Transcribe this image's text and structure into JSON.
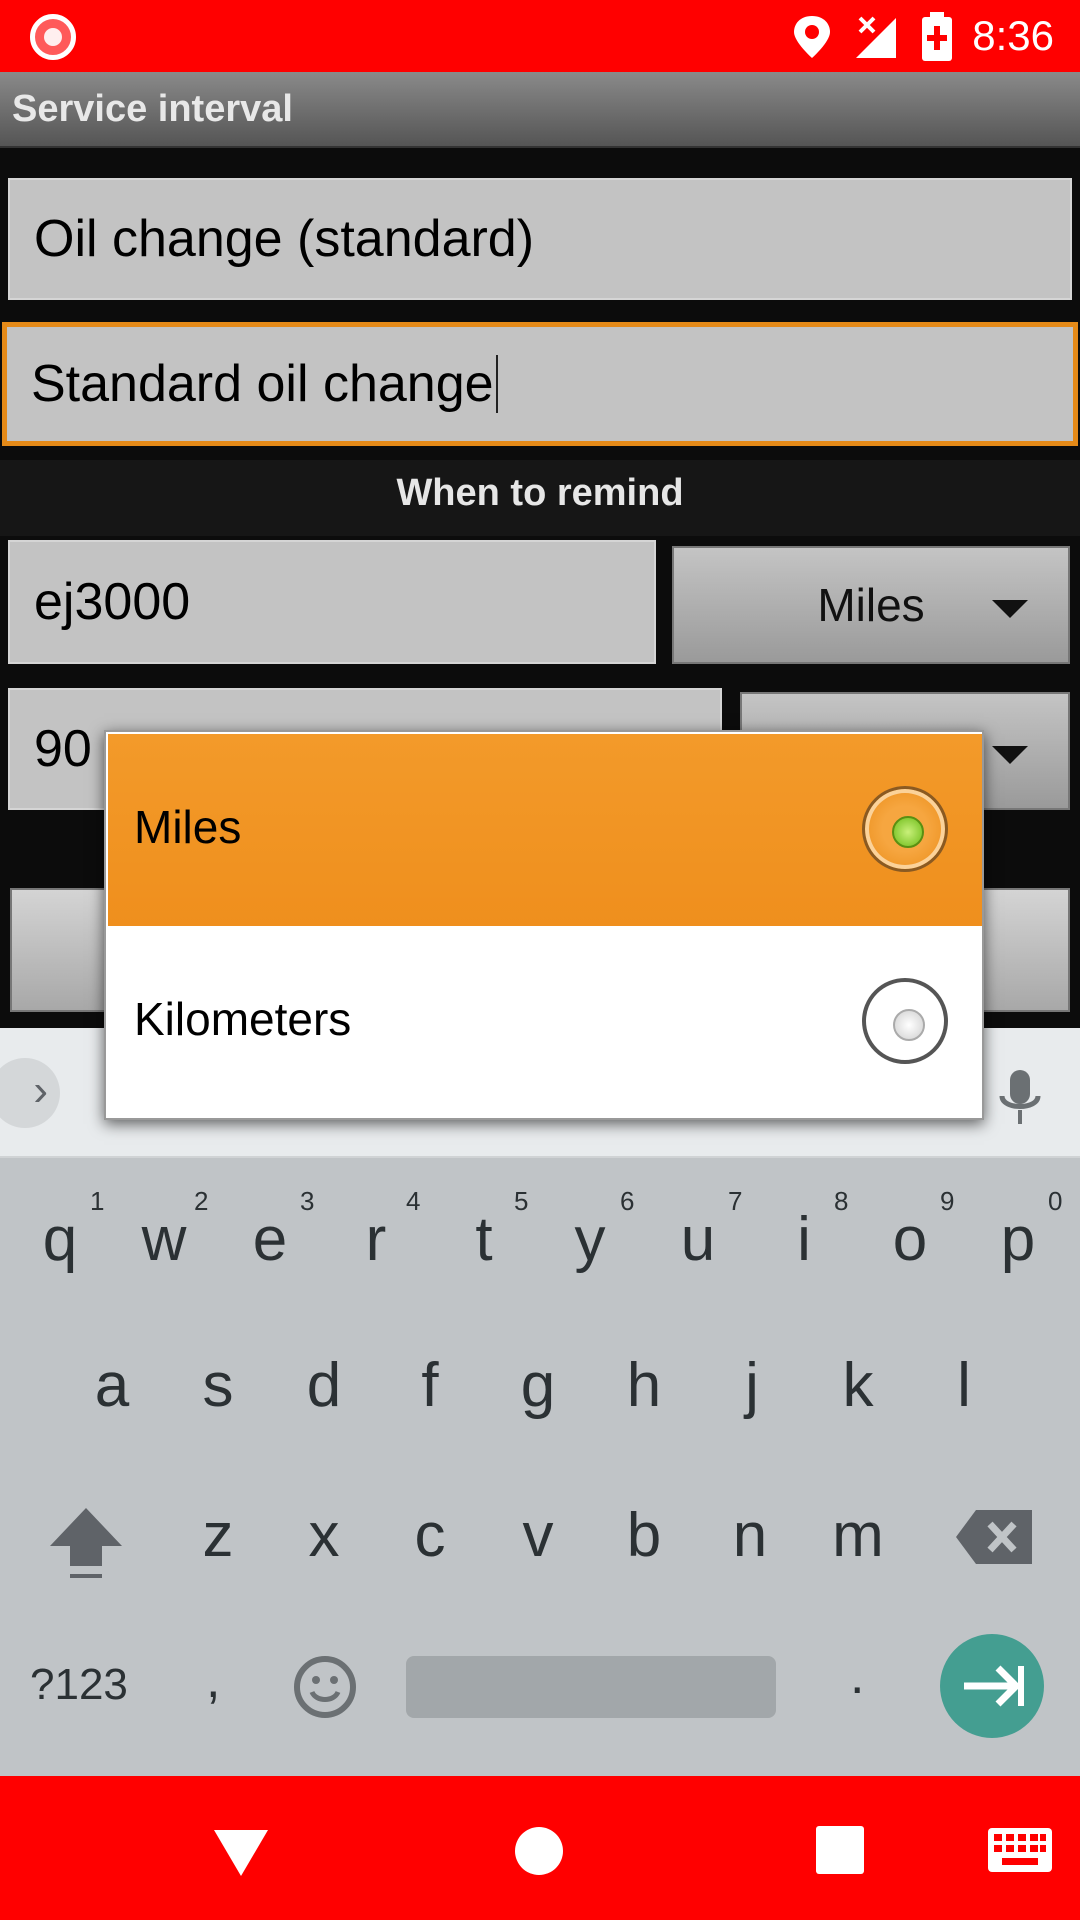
{
  "status_bar": {
    "time": "8:36",
    "icons": [
      "record-icon",
      "location-icon",
      "signal-off-icon",
      "battery-charging-icon"
    ]
  },
  "action_bar": {
    "title": "Service interval"
  },
  "form": {
    "name_value": "Oil change (standard)",
    "description_value": "Standard oil change",
    "when_header": "When to remind",
    "distance_value": "ej3000",
    "distance_unit": "Miles",
    "time_value_partial": "90"
  },
  "dialog": {
    "options": [
      {
        "label": "Miles",
        "selected": true
      },
      {
        "label": "Kilometers",
        "selected": false
      }
    ]
  },
  "keyboard": {
    "row1": [
      "q",
      "w",
      "e",
      "r",
      "t",
      "y",
      "u",
      "i",
      "o",
      "p"
    ],
    "row1_nums": [
      "1",
      "2",
      "3",
      "4",
      "5",
      "6",
      "7",
      "8",
      "9",
      "0"
    ],
    "row2": [
      "a",
      "s",
      "d",
      "f",
      "g",
      "h",
      "j",
      "k",
      "l"
    ],
    "row3": [
      "z",
      "x",
      "c",
      "v",
      "b",
      "n",
      "m"
    ],
    "symbols_label": "?123",
    "comma": ",",
    "period": "."
  },
  "colors": {
    "status_bar": "#ff0000",
    "accent": "#ef8f1d",
    "enter": "#449e91"
  }
}
